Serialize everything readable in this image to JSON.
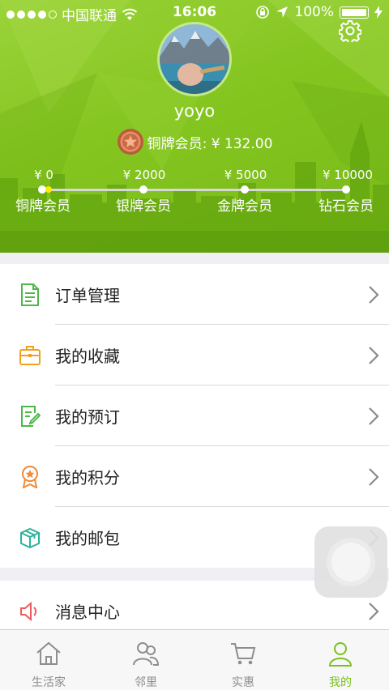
{
  "status_bar": {
    "carrier": "中国联通",
    "time": "16:06",
    "battery": "100%"
  },
  "profile": {
    "username": "yoyo",
    "member_text": "铜牌会员: ¥ 132.00"
  },
  "levels": [
    {
      "amount": "¥ 0",
      "name": "铜牌会员"
    },
    {
      "amount": "¥ 2000",
      "name": "银牌会员"
    },
    {
      "amount": "¥ 5000",
      "name": "金牌会员"
    },
    {
      "amount": "¥ 10000",
      "name": "钻石会员"
    }
  ],
  "progress": {
    "spent": 132.0,
    "max": 10000
  },
  "menu_group1": [
    {
      "label": "订单管理",
      "icon": "order-document-icon"
    },
    {
      "label": "我的收藏",
      "icon": "briefcase-icon"
    },
    {
      "label": "我的预订",
      "icon": "booking-edit-icon"
    },
    {
      "label": "我的积分",
      "icon": "points-badge-icon"
    },
    {
      "label": "我的邮包",
      "icon": "package-box-icon"
    }
  ],
  "menu_group2": [
    {
      "label": "消息中心",
      "icon": "speaker-icon"
    }
  ],
  "tabs": [
    {
      "label": "生活家",
      "icon": "home-icon"
    },
    {
      "label": "邻里",
      "icon": "people-icon"
    },
    {
      "label": "实惠",
      "icon": "cart-icon"
    },
    {
      "label": "我的",
      "icon": "person-icon",
      "active": true
    }
  ],
  "colors": {
    "accent": "#7bc022",
    "header_green": "#84c520",
    "progress_yellow": "#ffeb00"
  }
}
